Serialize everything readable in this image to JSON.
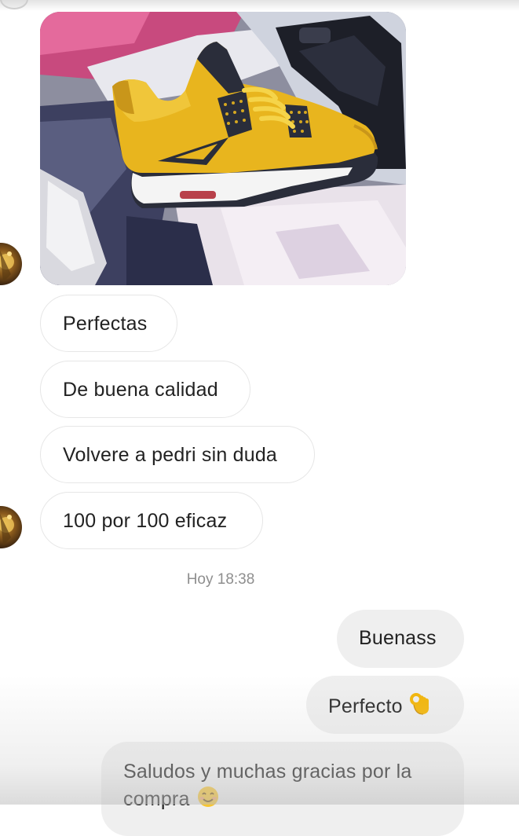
{
  "conversation": {
    "received_messages": [
      {
        "text": "Perfectas"
      },
      {
        "text": "De buena calidad"
      },
      {
        "text": "Volvere a pedri sin duda"
      },
      {
        "text": "100 por 100 eficaz"
      }
    ],
    "timestamp": "Hoy 18:38",
    "sent_messages": [
      {
        "text": "Buenass"
      },
      {
        "text": "Perfecto"
      },
      {
        "text": "Saludos y muchas gracias por la compra"
      }
    ],
    "sent_emojis": [
      "ok-hand-emoji",
      "smiling-face-emoji"
    ],
    "photo": {
      "subject": "yellow-sneaker-photo"
    }
  },
  "colors": {
    "received_bubble_bg": "#ffffff",
    "received_bubble_border": "#e6e6e6",
    "sent_bubble_bg": "#efefef",
    "text": "#222222",
    "timestamp": "#8e8e8e",
    "sneaker_yellow": "#e8b51e"
  }
}
